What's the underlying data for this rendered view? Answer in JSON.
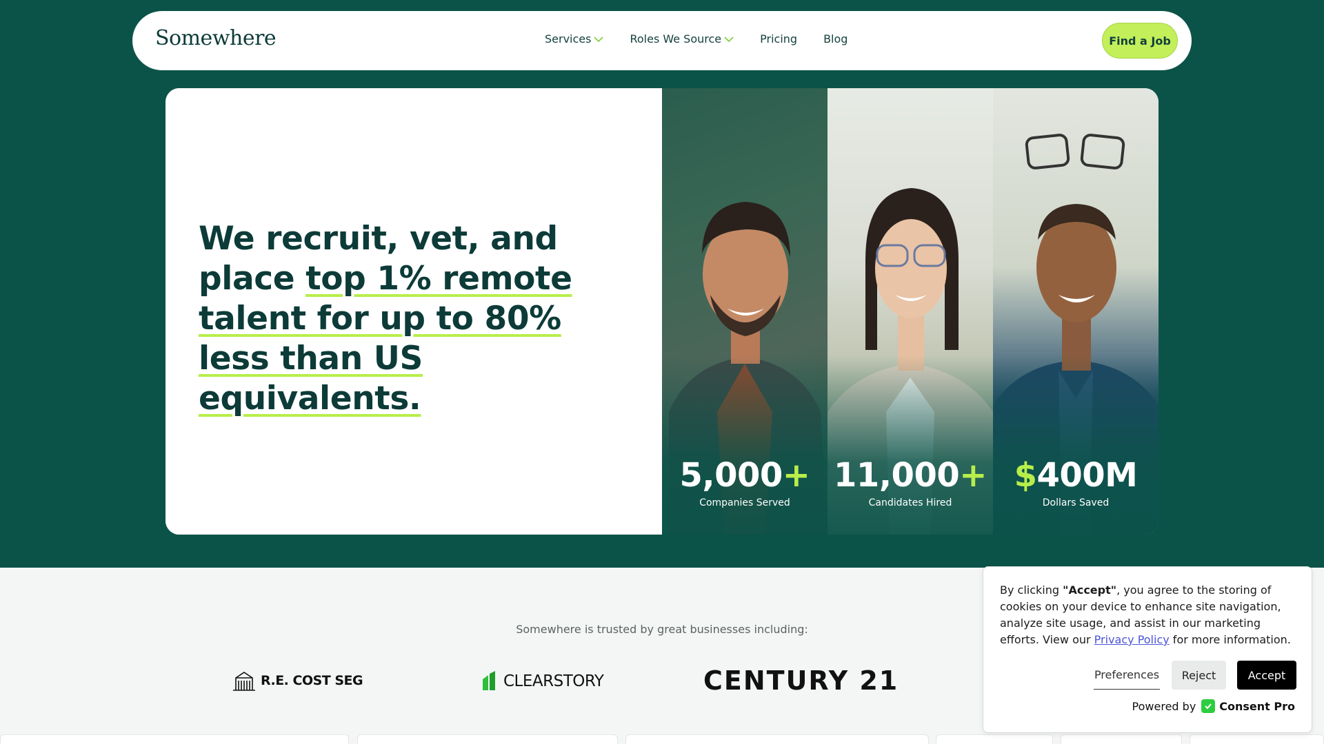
{
  "nav": {
    "logo": "Somewhere",
    "links": [
      {
        "label": "Services",
        "dropdown": true
      },
      {
        "label": "Roles We Source",
        "dropdown": true
      },
      {
        "label": "Pricing",
        "dropdown": false
      },
      {
        "label": "Blog",
        "dropdown": false
      }
    ],
    "cta": "Find a Job"
  },
  "hero": {
    "headline_plain": "We recruit, vet, and place",
    "headline_highlight": "top 1% remote talent for up to 80% less than US equivalents.",
    "stats": [
      {
        "prefix": "",
        "value": "5,000",
        "suffix": "+",
        "label": "Companies Served"
      },
      {
        "prefix": "$",
        "value": "400M",
        "suffix": "",
        "label": "Dollars Saved"
      },
      {
        "prefix": "",
        "value": "11,000",
        "suffix": "+",
        "label": "Candidates Hired"
      }
    ]
  },
  "trusted": {
    "text": "Somewhere is trusted by great businesses including:",
    "logos": [
      "R.E. COST SEG",
      "CLEARSTORY",
      "CENTURY 21"
    ]
  },
  "cookie": {
    "text_before": "By clicking ",
    "text_bold": "\"Accept\"",
    "text_after": ", you agree to the storing of cookies on your device to enhance site navigation, analyze site usage, and assist in our marketing efforts. View our ",
    "link": "Privacy Policy",
    "text_end": " for more information.",
    "preferences": "Preferences",
    "reject": "Reject",
    "accept": "Accept",
    "powered_by": "Powered by",
    "brand": "Consent Pro"
  },
  "colors": {
    "brand_green": "#0b5349",
    "accent_lime": "#b7ee4a",
    "text_dark": "#0c3b38"
  }
}
